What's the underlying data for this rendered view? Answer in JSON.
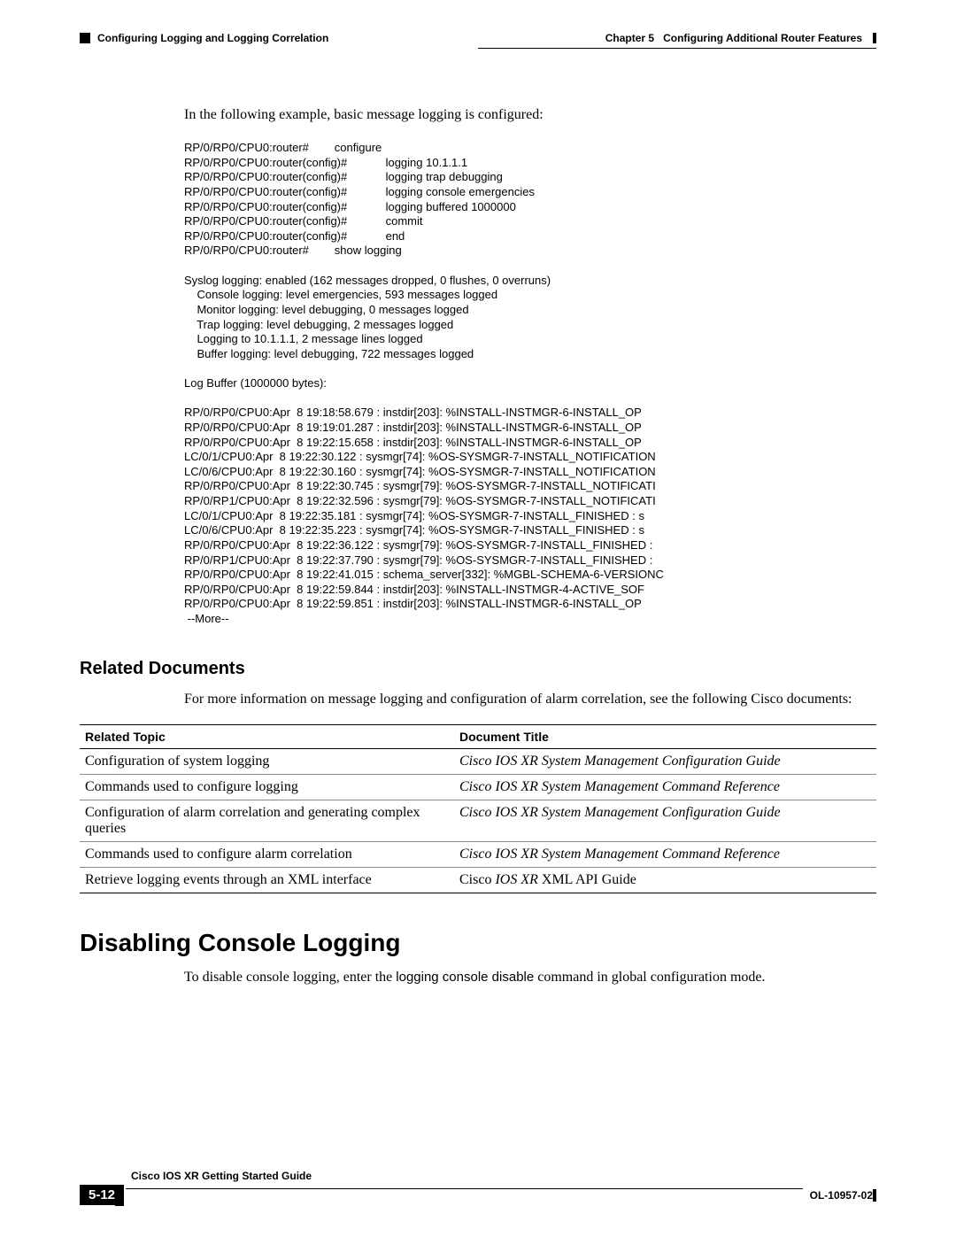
{
  "header": {
    "chapter": "Chapter 5",
    "title": "Configuring Additional Router Features",
    "section": "Configuring Logging and Logging Correlation"
  },
  "intro": "In the following example, basic message logging is configured:",
  "code": "RP/0/RP0/CPU0:router#        configure\nRP/0/RP0/CPU0:router(config)#            logging 10.1.1.1\nRP/0/RP0/CPU0:router(config)#            logging trap debugging\nRP/0/RP0/CPU0:router(config)#            logging console emergencies\nRP/0/RP0/CPU0:router(config)#            logging buffered 1000000\nRP/0/RP0/CPU0:router(config)#            commit\nRP/0/RP0/CPU0:router(config)#            end\nRP/0/RP0/CPU0:router#        show logging\n\nSyslog logging: enabled (162 messages dropped, 0 flushes, 0 overruns)\n    Console logging: level emergencies, 593 messages logged\n    Monitor logging: level debugging, 0 messages logged\n    Trap logging: level debugging, 2 messages logged\n    Logging to 10.1.1.1, 2 message lines logged\n    Buffer logging: level debugging, 722 messages logged\n\nLog Buffer (1000000 bytes):\n\nRP/0/RP0/CPU0:Apr  8 19:18:58.679 : instdir[203]: %INSTALL-INSTMGR-6-INSTALL_OP \nRP/0/RP0/CPU0:Apr  8 19:19:01.287 : instdir[203]: %INSTALL-INSTMGR-6-INSTALL_OP \nRP/0/RP0/CPU0:Apr  8 19:22:15.658 : instdir[203]: %INSTALL-INSTMGR-6-INSTALL_OP \nLC/0/1/CPU0:Apr  8 19:22:30.122 : sysmgr[74]: %OS-SYSMGR-7-INSTALL_NOTIFICATION \nLC/0/6/CPU0:Apr  8 19:22:30.160 : sysmgr[74]: %OS-SYSMGR-7-INSTALL_NOTIFICATION \nRP/0/RP0/CPU0:Apr  8 19:22:30.745 : sysmgr[79]: %OS-SYSMGR-7-INSTALL_NOTIFICATI \nRP/0/RP1/CPU0:Apr  8 19:22:32.596 : sysmgr[79]: %OS-SYSMGR-7-INSTALL_NOTIFICATI \nLC/0/1/CPU0:Apr  8 19:22:35.181 : sysmgr[74]: %OS-SYSMGR-7-INSTALL_FINISHED : s \nLC/0/6/CPU0:Apr  8 19:22:35.223 : sysmgr[74]: %OS-SYSMGR-7-INSTALL_FINISHED : s \nRP/0/RP0/CPU0:Apr  8 19:22:36.122 : sysmgr[79]: %OS-SYSMGR-7-INSTALL_FINISHED : \nRP/0/RP1/CPU0:Apr  8 19:22:37.790 : sysmgr[79]: %OS-SYSMGR-7-INSTALL_FINISHED : \nRP/0/RP0/CPU0:Apr  8 19:22:41.015 : schema_server[332]: %MGBL-SCHEMA-6-VERSIONC \nRP/0/RP0/CPU0:Apr  8 19:22:59.844 : instdir[203]: %INSTALL-INSTMGR-4-ACTIVE_SOF \nRP/0/RP0/CPU0:Apr  8 19:22:59.851 : instdir[203]: %INSTALL-INSTMGR-6-INSTALL_OP \n --More--",
  "related_heading": "Related Documents",
  "related_body": "For more information on message logging and configuration of alarm correlation, see the following Cisco documents:",
  "table": {
    "headers": {
      "topic": "Related Topic",
      "title": "Document Title"
    },
    "rows": [
      {
        "topic": "Configuration of system logging",
        "title": "Cisco IOS XR System Management Configuration Guide",
        "italic": true
      },
      {
        "topic": "Commands used to configure logging",
        "title": "Cisco IOS XR System Management Command Reference",
        "italic": true
      },
      {
        "topic": "Configuration of alarm correlation and generating complex queries",
        "title": "Cisco IOS XR System Management Configuration Guide",
        "italic": true
      },
      {
        "topic": "Commands used to configure alarm correlation",
        "title": "Cisco IOS XR System Management Command Reference",
        "italic": true
      },
      {
        "topic": "Retrieve logging events through an XML interface",
        "title": "Cisco IOS XR XML API Guide",
        "italic": false,
        "partial_italic": "IOS XR"
      }
    ]
  },
  "disable_heading": "Disabling Console Logging",
  "disable_body_pre": "To disable console logging, enter the ",
  "disable_cmd": "logging console disable",
  "disable_body_post": " command in global configuration mode.",
  "footer": {
    "guide": "Cisco IOS XR Getting Started Guide",
    "page": "5-12",
    "doc": "OL-10957-02"
  }
}
